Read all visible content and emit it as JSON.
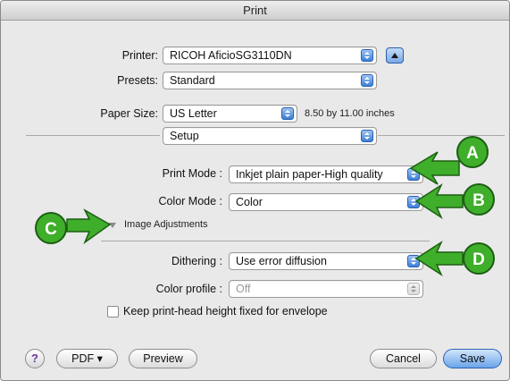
{
  "window": {
    "title": "Print"
  },
  "printer": {
    "label": "Printer:",
    "value": "RICOH AficioSG3110DN"
  },
  "presets": {
    "label": "Presets:",
    "value": "Standard"
  },
  "paper": {
    "label": "Paper Size:",
    "value": "US Letter",
    "dimensions": "8.50 by 11.00 inches"
  },
  "panel": {
    "value": "Setup"
  },
  "print_mode": {
    "label": "Print Mode :",
    "value": "Inkjet plain paper-High quality"
  },
  "color_mode": {
    "label": "Color Mode :",
    "value": "Color"
  },
  "image_adjustments": {
    "label": "Image Adjustments"
  },
  "dithering": {
    "label": "Dithering :",
    "value": "Use error diffusion"
  },
  "color_profile": {
    "label": "Color profile :",
    "value": "Off"
  },
  "envelope": {
    "label": "Keep print-head height fixed for envelope",
    "checked": false
  },
  "buttons": {
    "help": "?",
    "pdf": "PDF ▾",
    "preview": "Preview",
    "cancel": "Cancel",
    "save": "Save"
  },
  "callouts": {
    "a": "A",
    "b": "B",
    "c": "C",
    "d": "D"
  },
  "colors": {
    "callout_green": "#3fae2a",
    "accent_blue": "#3c7fd8"
  }
}
